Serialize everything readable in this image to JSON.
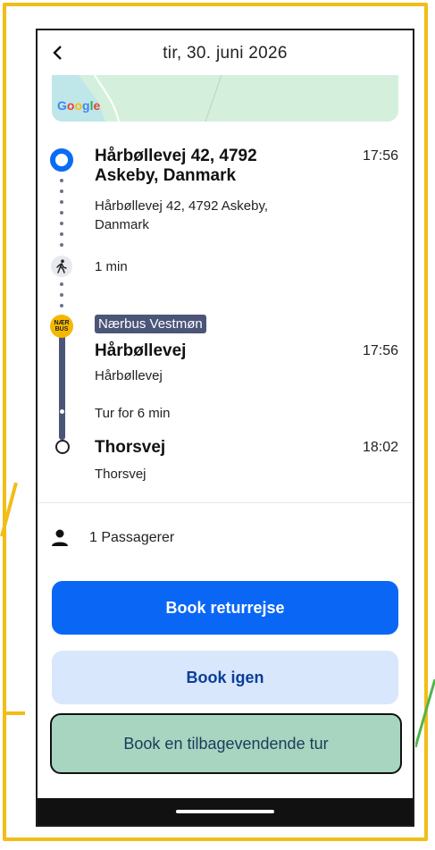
{
  "header": {
    "back_icon": "chevron-left-icon",
    "date": "tir, 30. juni 2026"
  },
  "map": {
    "logo": "Google"
  },
  "trip": {
    "origin": {
      "title": "Hårbøllevej 42, 4792 Askeby, Danmark",
      "title_line1": "Hårbøllevej 42, 4792",
      "title_line2": "Askeby, Danmark",
      "address_line1": "Hårbøllevej 42, 4792 Askeby,",
      "address_line2": "Danmark",
      "time": "17:56"
    },
    "walk": {
      "icon": "walking-icon",
      "duration": "1 min"
    },
    "bus": {
      "badge_line1": "NÆR",
      "badge_line2": "BUS",
      "route_name": "Nærbus Vestmøn",
      "board_stop": "Hårbøllevej",
      "board_stop_sub": "Hårbøllevej",
      "board_time": "17:56",
      "duration": "Tur for 6 min",
      "alight_stop": "Thorsvej",
      "alight_stop_sub": "Thorsvej",
      "alight_time": "18:02"
    }
  },
  "passengers": {
    "icon": "person-icon",
    "label": "1 Passagerer"
  },
  "actions": {
    "book_return": "Book returrejse",
    "book_again": "Book igen",
    "book_recurring": "Book en tilbagevendende tur"
  },
  "colors": {
    "primary": "#0a67f5",
    "route_tag": "#4b5578",
    "bus_badge": "#f5b800",
    "frame": "#f2bd16"
  }
}
